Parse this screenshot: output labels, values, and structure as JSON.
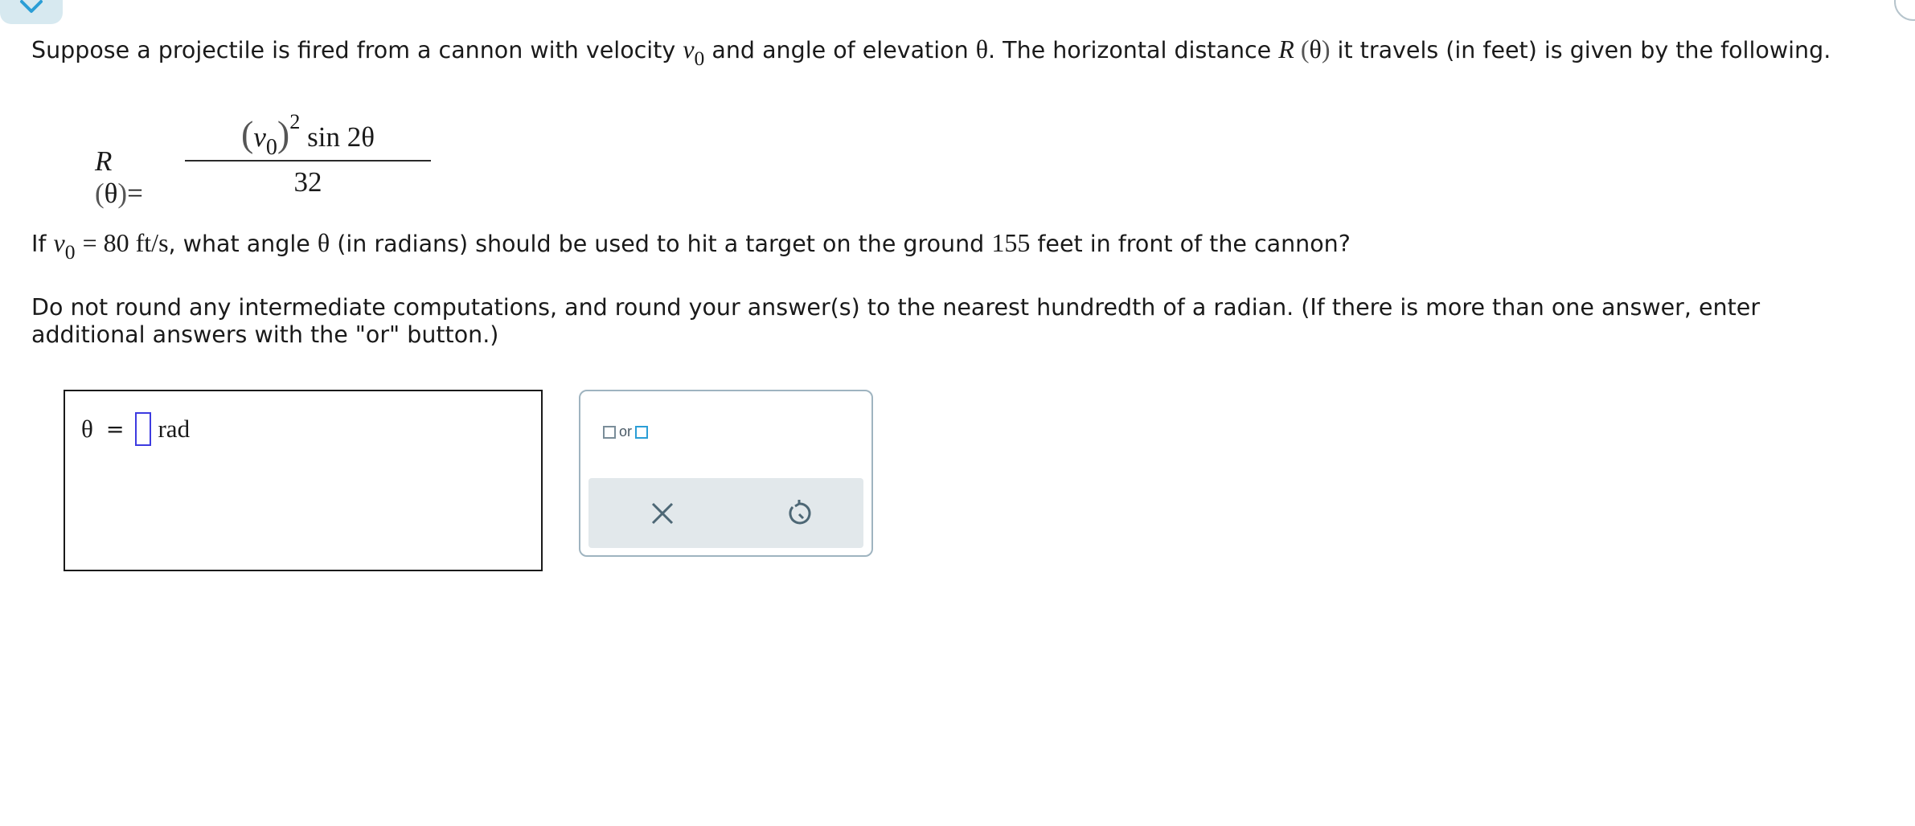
{
  "problem": {
    "intro": {
      "text1": "Suppose a projectile is fired from a cannon with velocity",
      "text2": "and angle of elevation",
      "text3": ". The horizontal distance",
      "text4": "it travels (in feet) is given by the following."
    },
    "symbols": {
      "v": "v",
      "zero": "0",
      "theta": "θ",
      "R": "R",
      "open_paren": "(",
      "close_paren": ")"
    },
    "formula": {
      "equals": "=",
      "exponent": "2",
      "sin_part": "sin 2θ",
      "denominator": "32"
    },
    "question": {
      "text1": "If",
      "given_velocity": "= 80 ft/s",
      "text2": ", what angle",
      "text3": "(in radians) should be used to hit a target on the ground",
      "distance": "155",
      "text4": "feet in front of the cannon?"
    },
    "instructions": "Do not round any intermediate computations, and round your answer(s) to the nearest hundredth of a radian. (If there is more than one answer, enter additional answers with the \"or\" button.)"
  },
  "answer": {
    "variable": "θ",
    "equals": "=",
    "value": "",
    "unit": "rad"
  },
  "tools": {
    "or_label": "or",
    "clear_icon": "close-icon",
    "reset_icon": "undo-icon"
  },
  "colors": {
    "accent_input_border": "#3d3be0",
    "tab_bg": "#d7e9f0",
    "panel_border": "#9fb4c0",
    "action_bar_bg": "#e2e8eb",
    "icon_color": "#4d6775"
  }
}
